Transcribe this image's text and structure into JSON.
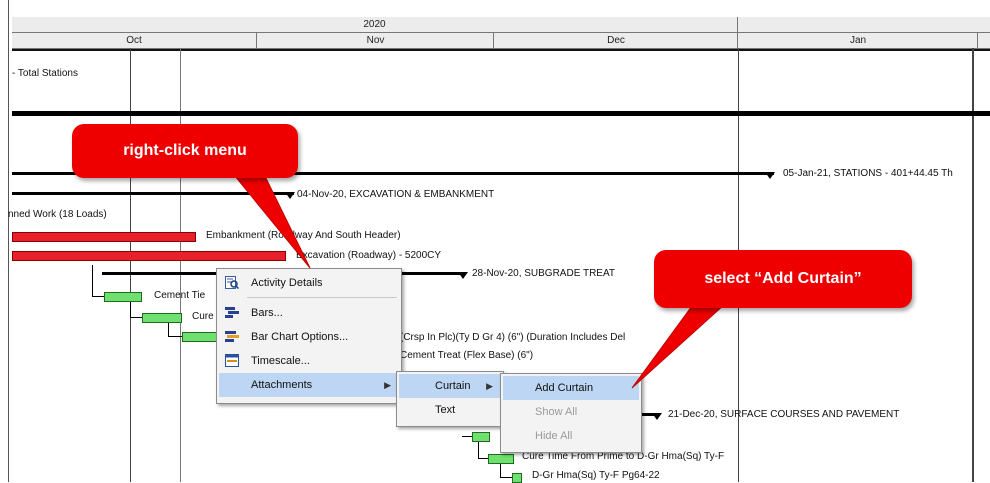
{
  "timescale": {
    "year": "2020",
    "months": [
      "Oct",
      "Nov",
      "Dec",
      "Jan"
    ]
  },
  "gantt": {
    "label_total_stations": "- Total Stations",
    "label_stations": "05-Jan-21, STATIONS - 401+44.45 Th",
    "label_excavation": "04-Nov-20, EXCAVATION & EMBANKMENT",
    "label_planned_work": "nned Work (18 Loads)",
    "label_embankment": "Embankment (Roadway And South Header)",
    "label_excavation_roadway": "Excavation (Roadway) - 5200CY",
    "label_subgrade": "28-Nov-20, SUBGRADE TREAT",
    "label_cement_tie": "Cement Tie",
    "label_cure": "Cure",
    "label_crsp": "(Crsp In Plc)(Ty D Gr 4) (6\") (Duration Includes Del",
    "label_cement_treat": "Cement Treat (Flex Base) (6\")",
    "label_surface": "21-Dec-20, SURFACE COURSES AND PAVEMENT",
    "label_cure_time": "Cure Time From Prime to D-Gr Hma(Sq) Ty-F",
    "label_dgr": "D-Gr Hma(Sq) Ty-F Pg64-22"
  },
  "context_menu": {
    "items": [
      {
        "label": "Activity Details",
        "icon": "activity-details-icon"
      },
      {
        "label": "Bars...",
        "icon": "bars-icon"
      },
      {
        "label": "Bar Chart Options...",
        "icon": "bar-chart-options-icon"
      },
      {
        "label": "Timescale...",
        "icon": "timescale-icon"
      },
      {
        "label": "Attachments",
        "icon": "",
        "submenu": true
      }
    ]
  },
  "attachments_submenu": {
    "items": [
      {
        "label": "Curtain",
        "submenu": true
      },
      {
        "label": "Text"
      }
    ]
  },
  "curtain_submenu": {
    "items": [
      {
        "label": "Add Curtain",
        "enabled": true
      },
      {
        "label": "Show All",
        "enabled": false
      },
      {
        "label": "Hide All",
        "enabled": false
      }
    ]
  },
  "callouts": {
    "right_click": "right-click menu",
    "select": "select “Add Curtain”"
  },
  "colors": {
    "highlight": "#bcd6f3",
    "callout_red": "#ee0000",
    "bar_red": "#e8202a",
    "bar_green": "#6fe06f"
  }
}
